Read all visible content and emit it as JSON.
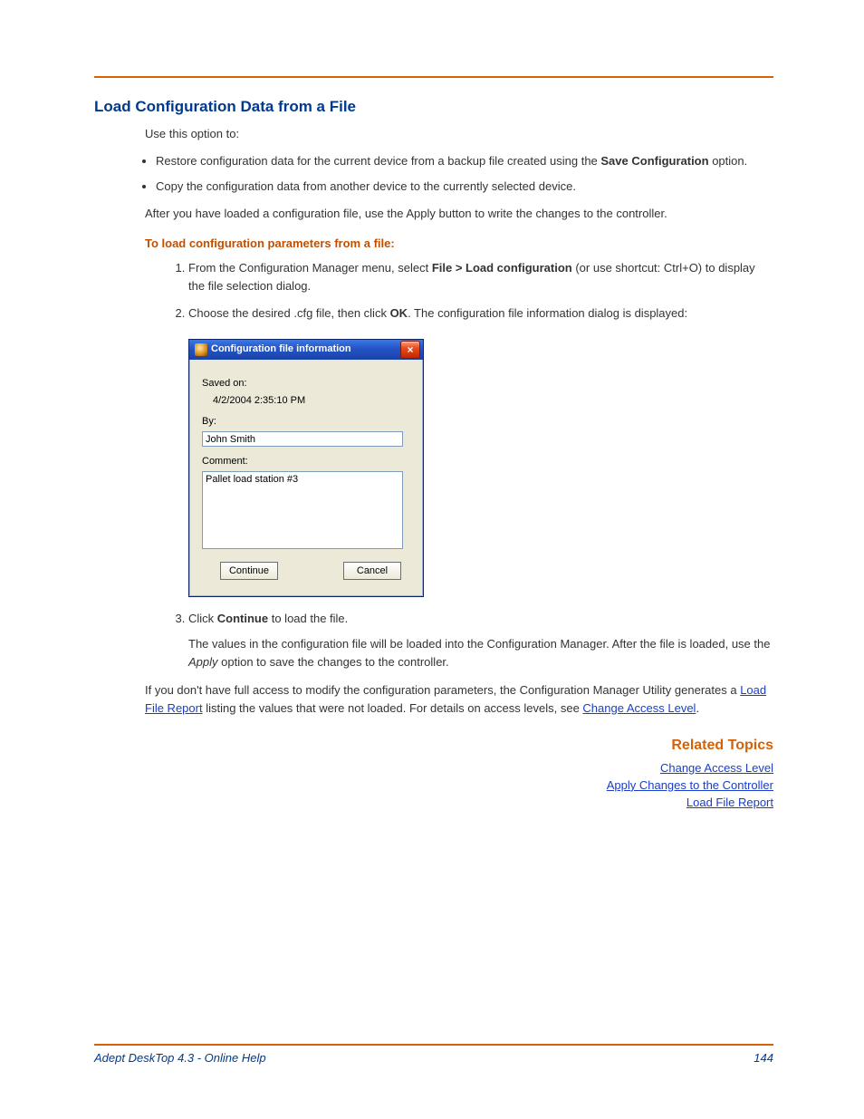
{
  "heading": "Load Configuration Data from a File",
  "intro": "Use this option to:",
  "bullets": {
    "b1a": "Restore configuration data for the current device from a backup file created using the ",
    "b1b": "Save Configuration",
    "b1c": " option.",
    "b2": "Copy the configuration data from another device to the currently selected device."
  },
  "after_bullets": "After you have loaded a configuration file, use the Apply button to write the changes to the controller.",
  "subheading": "To load configuration parameters from a file:",
  "steps": {
    "s1a": "From the Configuration Manager menu, select ",
    "s1b": "File > Load configuration",
    "s1c": " (or use shortcut: Ctrl+O) to display the file selection dialog.",
    "s2a": "Choose the desired .cfg file, then click ",
    "s2b": "OK",
    "s2c": ". The configuration file information dialog is displayed:",
    "s3a": "Click ",
    "s3b": "Continue",
    "s3c": " to load the file.",
    "s3_after_a": "The values in the configuration file will be loaded into the Configuration Manager. After the file is loaded, use the ",
    "s3_after_b": "Apply",
    "s3_after_c": " option to save the changes to the controller."
  },
  "dialog": {
    "title": "Configuration file information",
    "close": "×",
    "saved_on_label": "Saved on:",
    "saved_on_value": "4/2/2004 2:35:10 PM",
    "by_label": "By:",
    "by_value": "John Smith",
    "comment_label": "Comment:",
    "comment_value": "Pallet load station #3",
    "continue_btn": "Continue",
    "cancel_btn": "Cancel"
  },
  "access_para": {
    "p1": "If you don't have full access to modify the configuration parameters, the Configuration Manager Utility generates a ",
    "link1": "Load File Report",
    "p2": " listing the values that were not loaded. For details on access levels, see ",
    "link2": "Change Access Level",
    "p3": "."
  },
  "related": {
    "heading": "Related Topics",
    "links": {
      "l1": "Change Access Level",
      "l2": "Apply Changes to the Controller",
      "l3": "Load File Report"
    }
  },
  "footer": {
    "left": "Adept DeskTop 4.3  - Online Help",
    "right": "144"
  }
}
